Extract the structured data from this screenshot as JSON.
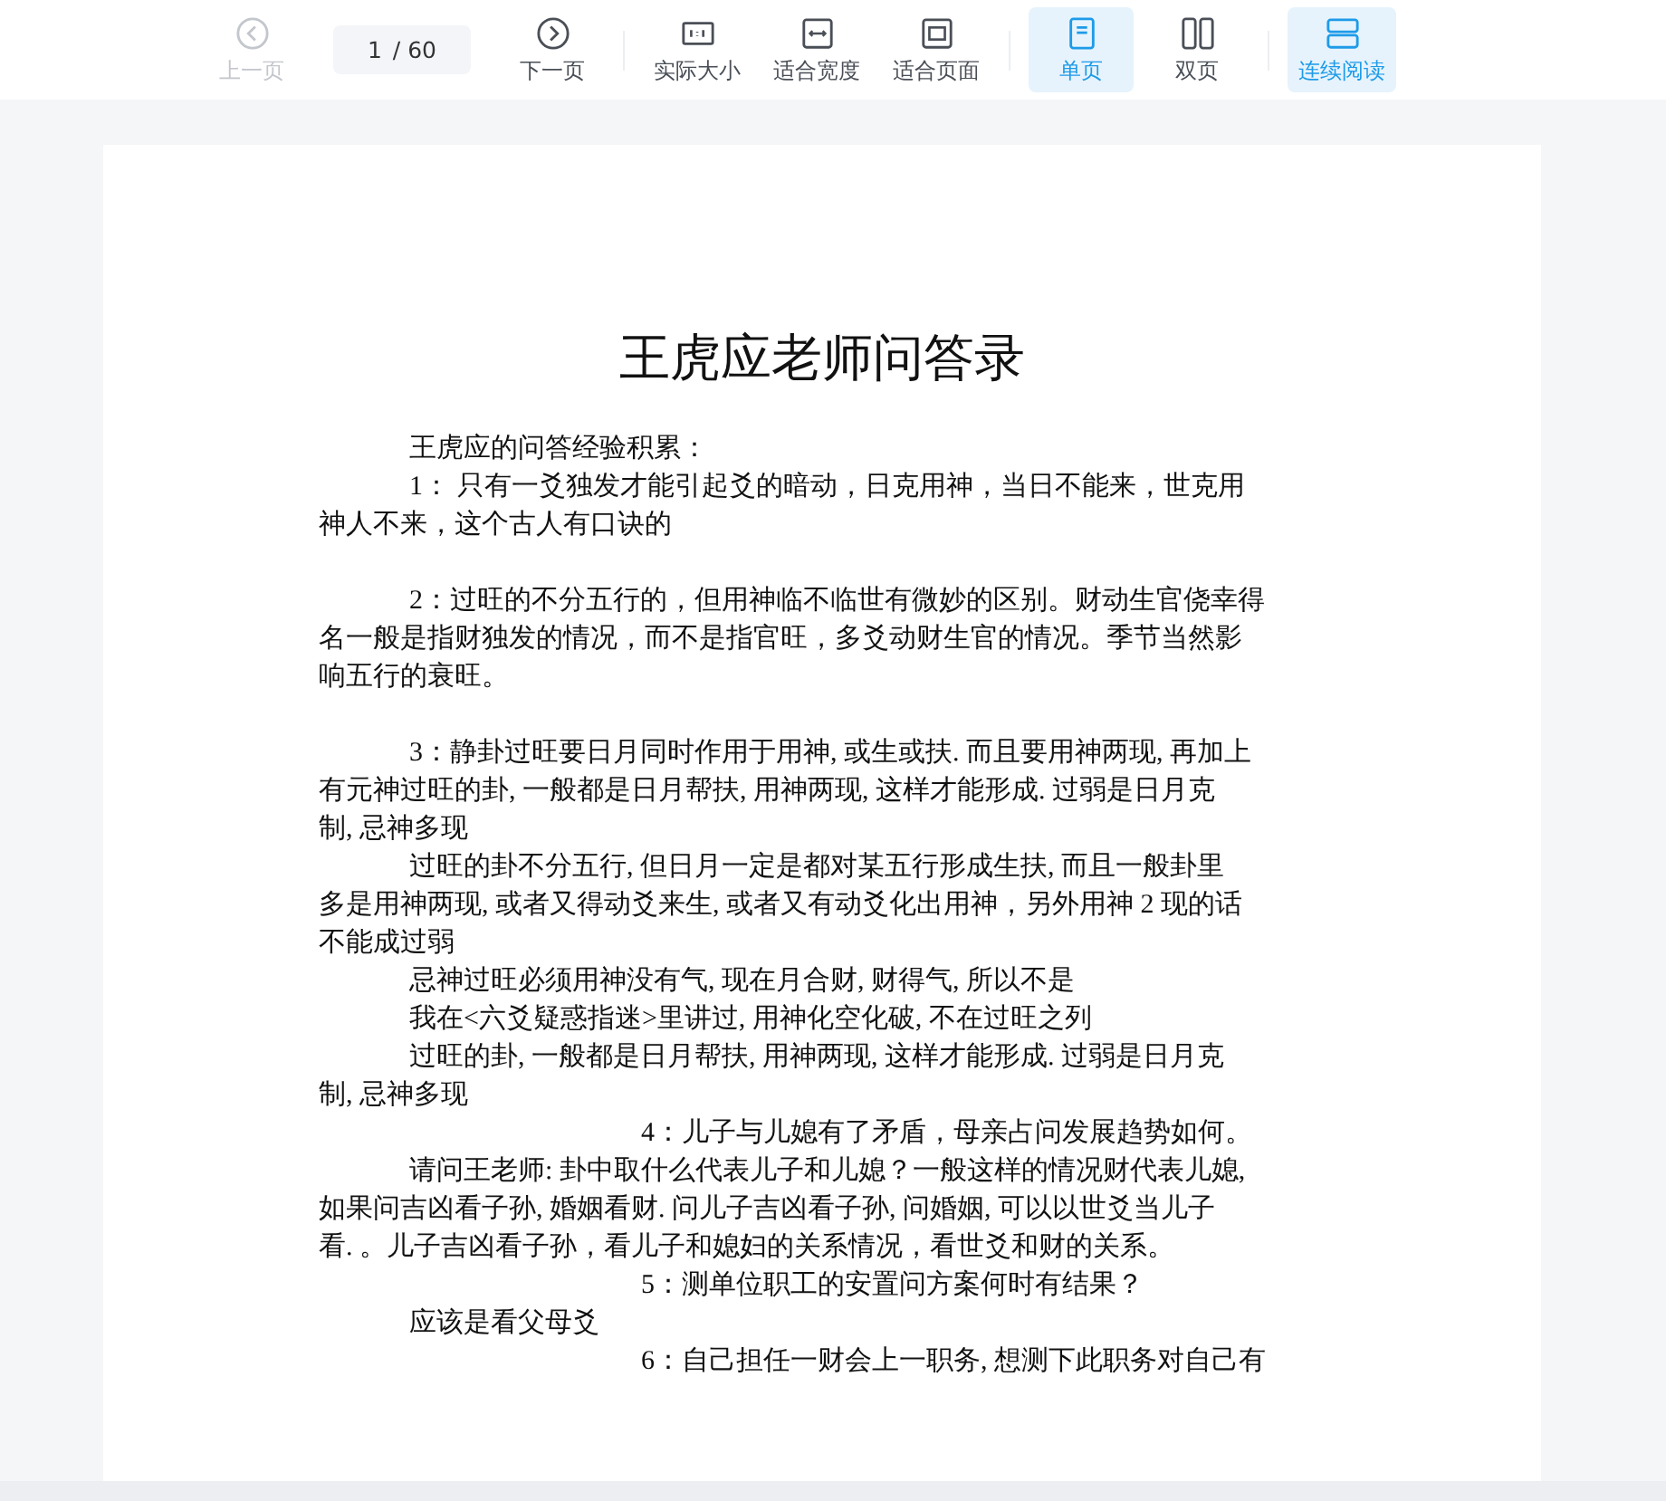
{
  "toolbar": {
    "groups": [
      [
        {
          "label": "上一页",
          "disabled": true,
          "selected": false
        },
        {
          "kind": "page",
          "current": "1",
          "total": "/ 60"
        },
        {
          "label": "下一页",
          "disabled": false,
          "selected": false
        }
      ],
      [
        {
          "label": "实际大小",
          "disabled": false,
          "selected": false
        },
        {
          "label": "适合宽度",
          "disabled": false,
          "selected": false
        },
        {
          "label": "适合页面",
          "disabled": false,
          "selected": false
        }
      ],
      [
        {
          "label": "单页",
          "disabled": false,
          "selected": true
        },
        {
          "label": "双页",
          "disabled": false,
          "selected": false
        }
      ],
      [
        {
          "label": "连续阅读",
          "disabled": false,
          "selected": true
        }
      ]
    ]
  },
  "document": {
    "title": "王虎应老师问答录",
    "paragraphs": [
      {
        "kind": "body",
        "gap_after": false,
        "lines": [
          "王虎应的问答经验积累："
        ]
      },
      {
        "kind": "body",
        "gap_after": true,
        "lines": [
          "1：  只有一爻独发才能引起爻的暗动，日克用神，当日不能来，世克用",
          "神人不来，这个古人有口诀的"
        ]
      },
      {
        "kind": "body",
        "gap_after": true,
        "lines": [
          "2：过旺的不分五行的，但用神临不临世有微妙的区别。财动生官侥幸得",
          "名一般是指财独发的情况，而不是指官旺，多爻动财生官的情况。季节当然影",
          "响五行的衰旺。"
        ]
      },
      {
        "kind": "body",
        "gap_after": false,
        "lines": [
          "3：静卦过旺要日月同时作用于用神, 或生或扶. 而且要用神两现, 再加上",
          "有元神过旺的卦, 一般都是日月帮扶, 用神两现, 这样才能形成. 过弱是日月克",
          "制, 忌神多现"
        ]
      },
      {
        "kind": "body",
        "gap_after": false,
        "lines": [
          "过旺的卦不分五行, 但日月一定是都对某五行形成生扶, 而且一般卦里",
          "多是用神两现, 或者又得动爻来生, 或者又有动爻化出用神，另外用神 2 现的话",
          "不能成过弱"
        ]
      },
      {
        "kind": "body",
        "gap_after": false,
        "lines": [
          "忌神过旺必须用神没有气, 现在月合财, 财得气, 所以不是"
        ]
      },
      {
        "kind": "body",
        "gap_after": false,
        "lines": [
          "我在<六爻疑惑指迷>里讲过, 用神化空化破, 不在过旺之列"
        ]
      },
      {
        "kind": "body",
        "gap_after": false,
        "lines": [
          "过旺的卦, 一般都是日月帮扶, 用神两现, 这样才能形成. 过弱是日月克",
          "制, 忌神多现"
        ]
      },
      {
        "kind": "question",
        "gap_after": false,
        "lines": [
          "4：儿子与儿媳有了矛盾，母亲占问发展趋势如何。"
        ]
      },
      {
        "kind": "body",
        "gap_after": false,
        "lines": [
          "请问王老师: 卦中取什么代表儿子和儿媳？一般这样的情况财代表儿媳,",
          "如果问吉凶看子孙, 婚姻看财. 问儿子吉凶看子孙, 问婚姻, 可以以世爻当儿子",
          "看. 。儿子吉凶看子孙，看儿子和媳妇的关系情况，看世爻和财的关系。"
        ]
      },
      {
        "kind": "question",
        "gap_after": false,
        "lines": [
          "5：测单位职工的安置问方案何时有结果？"
        ]
      },
      {
        "kind": "body",
        "gap_after": false,
        "lines": [
          "应该是看父母爻"
        ]
      },
      {
        "kind": "question",
        "gap_after": false,
        "lines": [
          "6：自己担任一财会上一职务, 想测下此职务对自己有"
        ]
      }
    ]
  }
}
